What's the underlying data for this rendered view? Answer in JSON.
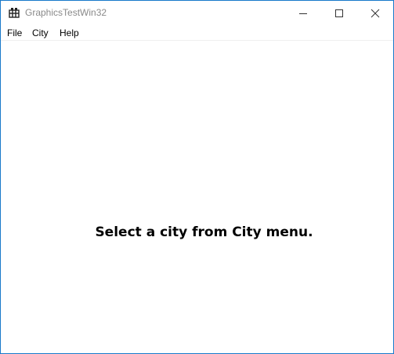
{
  "window": {
    "title": "GraphicsTestWin32",
    "accent_color": "#1979ca"
  },
  "titlebar": {
    "app_icon": "app-icon",
    "buttons": {
      "minimize_icon": "minimize-icon",
      "maximize_icon": "maximize-icon",
      "close_icon": "close-icon"
    }
  },
  "menu": {
    "items": [
      {
        "label": "File"
      },
      {
        "label": "City"
      },
      {
        "label": "Help"
      }
    ]
  },
  "client": {
    "message": "Select a city from City menu."
  }
}
